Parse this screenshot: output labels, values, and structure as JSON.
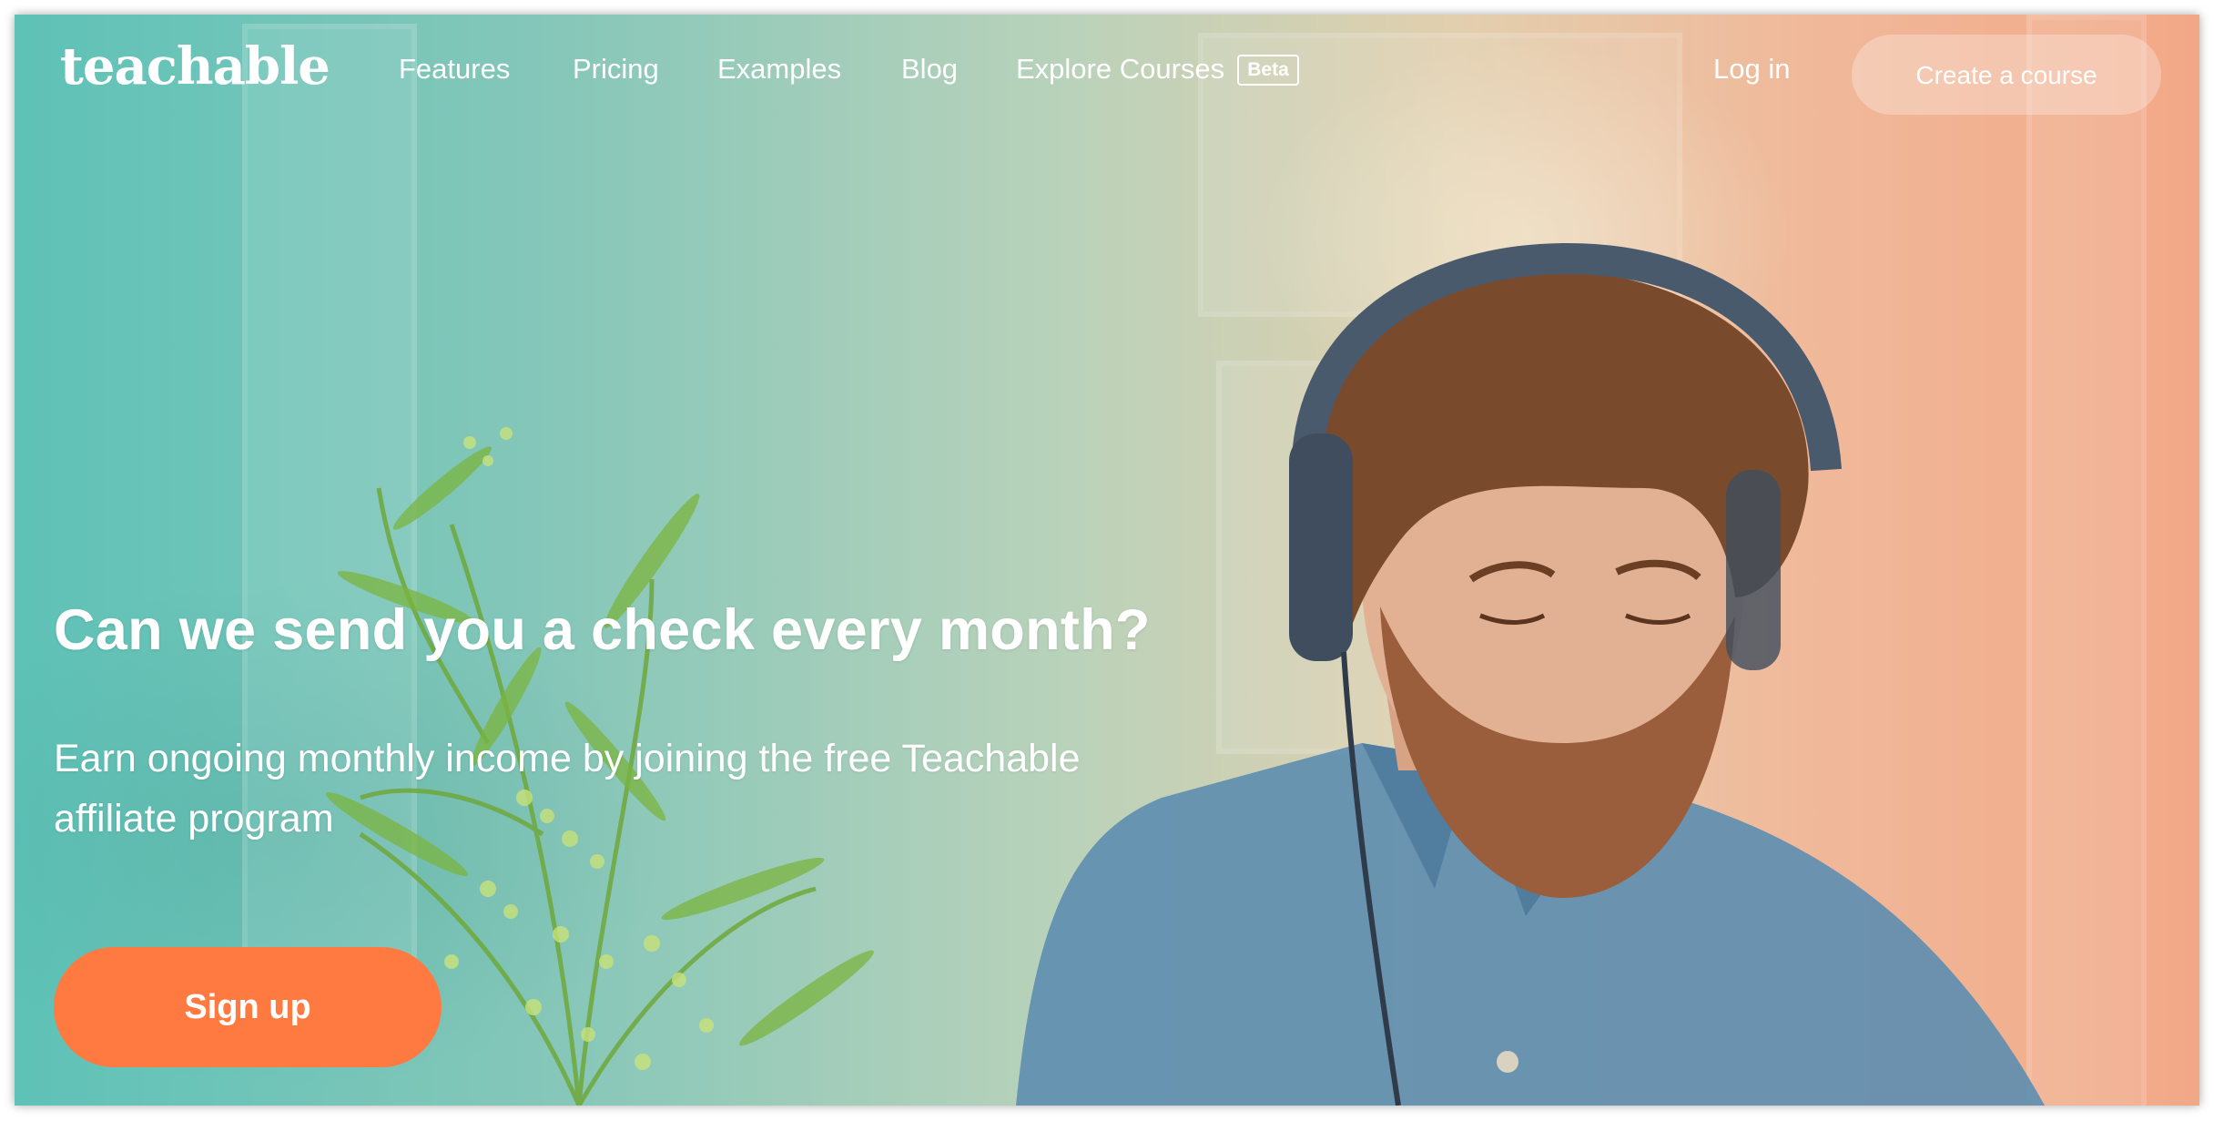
{
  "brand": {
    "logo_text": "teachable"
  },
  "nav": {
    "links": [
      {
        "label": "Features"
      },
      {
        "label": "Pricing"
      },
      {
        "label": "Examples"
      },
      {
        "label": "Blog"
      },
      {
        "label": "Explore Courses"
      }
    ],
    "explore_badge": "Beta",
    "login_label": "Log in",
    "create_course_label": "Create a course"
  },
  "hero": {
    "headline": "Can we send you a check every month?",
    "subtext": "Earn ongoing monthly income by joining the free Teachable affiliate program",
    "signup_label": "Sign up",
    "background_image": "man-with-headphones-photo"
  },
  "colors": {
    "accent_orange": "#ff7a40",
    "overlay_teal": "#5ec2b7",
    "overlay_peach": "#f2a887",
    "text": "#ffffff"
  }
}
